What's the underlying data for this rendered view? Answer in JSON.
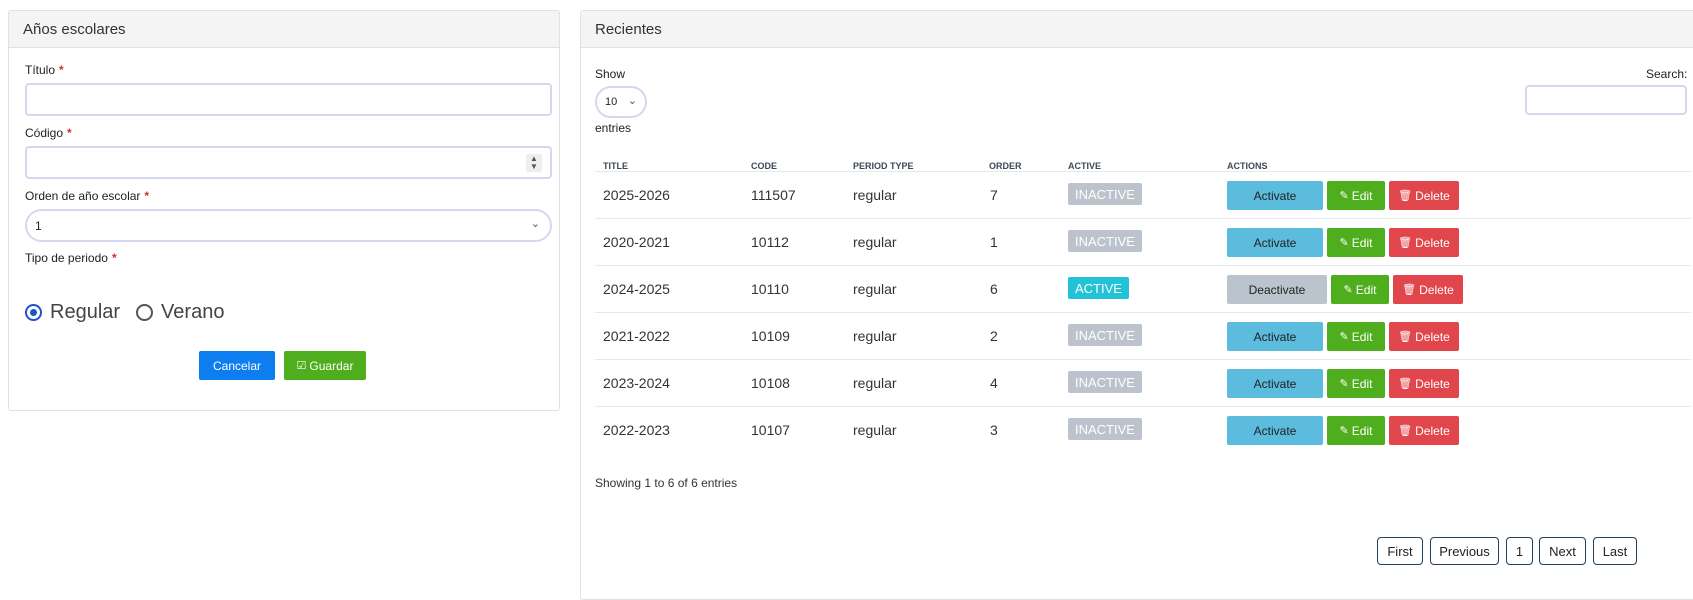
{
  "form": {
    "title": "Años escolares",
    "fields": {
      "titulo_label": "Título",
      "codigo_label": "Código",
      "orden_label": "Orden de año escolar",
      "orden_value": "1",
      "tipo_label": "Tipo de periodo",
      "required_mark": "*"
    },
    "radios": [
      {
        "label": "Regular",
        "checked": true
      },
      {
        "label": "Verano",
        "checked": false
      }
    ],
    "cancel_label": "Cancelar",
    "save_label": "Guardar"
  },
  "list": {
    "title": "Recientes",
    "show_label": "Show",
    "entries_value": "10",
    "entries_label": "entries",
    "search_label": "Search:",
    "columns": [
      "TITLE",
      "CODE",
      "PERIOD TYPE",
      "ORDER",
      "ACTIVE",
      "ACTIONS"
    ],
    "rows": [
      {
        "title": "2025-2026",
        "code": "111507",
        "period": "regular",
        "order": "7",
        "status": "INACTIVE",
        "toggle": "Activate"
      },
      {
        "title": "2020-2021",
        "code": "10112",
        "period": "regular",
        "order": "1",
        "status": "INACTIVE",
        "toggle": "Activate"
      },
      {
        "title": "2024-2025",
        "code": "10110",
        "period": "regular",
        "order": "6",
        "status": "ACTIVE",
        "toggle": "Deactivate"
      },
      {
        "title": "2021-2022",
        "code": "10109",
        "period": "regular",
        "order": "2",
        "status": "INACTIVE",
        "toggle": "Activate"
      },
      {
        "title": "2023-2024",
        "code": "10108",
        "period": "regular",
        "order": "4",
        "status": "INACTIVE",
        "toggle": "Activate"
      },
      {
        "title": "2022-2023",
        "code": "10107",
        "period": "regular",
        "order": "3",
        "status": "INACTIVE",
        "toggle": "Activate"
      }
    ],
    "edit_label": "Edit",
    "delete_label": "Delete",
    "summary": "Showing 1 to 6 of 6 entries",
    "pagination": [
      "First",
      "Previous",
      "1",
      "Next",
      "Last"
    ]
  },
  "colors": {
    "primary": "#0d7eef",
    "success": "#4fae1d",
    "info": "#5bbcdd",
    "danger": "#e0464b",
    "active_badge": "#22c3d6",
    "inactive_badge": "#bdc3cc"
  }
}
